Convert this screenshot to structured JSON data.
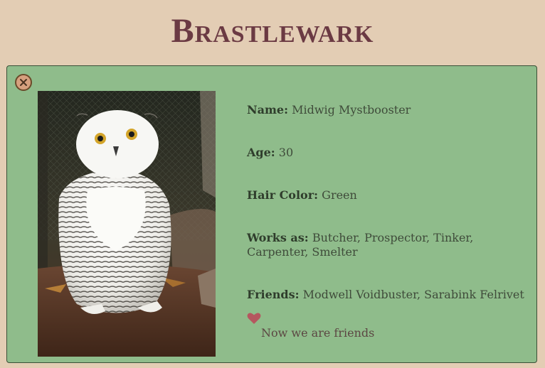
{
  "app": {
    "title": "Brastlewark"
  },
  "profile": {
    "close_icon": "close-x-icon",
    "photo_alt": "Snowy owl",
    "fields": {
      "name_label": "Name:",
      "name_value": "Midwig Mystbooster",
      "age_label": "Age:",
      "age_value": "30",
      "hair_label": "Hair Color:",
      "hair_value": "Green",
      "works_label": "Works as:",
      "works_value": "Butcher, Prospector, Tinker, Carpenter, Smelter",
      "friends_label": "Friends:",
      "friends_value": "Modwell Voidbuster, Sarabink Felrivet"
    },
    "friendship": {
      "icon": "heart-icon",
      "status_text": "Now we are friends"
    }
  },
  "colors": {
    "background": "#e3cdb4",
    "title": "#6b3a43",
    "card": "#8fbc8b",
    "card_border": "#3a4f37",
    "heart": "#b5575f",
    "close_button_fill": "#d6a07e",
    "close_button_border": "#6a4a2a"
  }
}
